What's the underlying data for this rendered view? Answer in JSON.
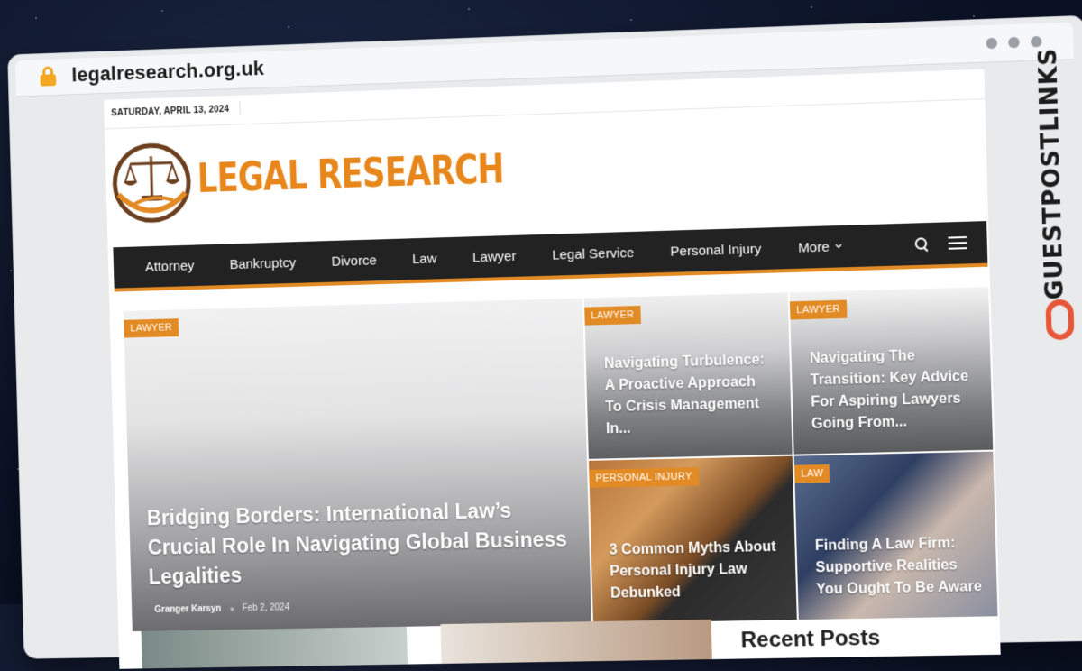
{
  "browser": {
    "url": "legalresearch.org.uk",
    "side_brand": "GUESTPOSTLINKS"
  },
  "site": {
    "date": "SATURDAY, APRIL 13, 2024",
    "name": "LEGAL RESEARCH",
    "nav": [
      "Attorney",
      "Bankruptcy",
      "Divorce",
      "Law",
      "Lawyer",
      "Legal Service",
      "Personal Injury"
    ],
    "more_label": "More"
  },
  "featured": {
    "big": {
      "tag": "LAWYER",
      "title": "Bridging Borders: International Law’s Crucial Role In Navigating Global Business Legalities",
      "author": "Granger Karsyn",
      "date": "Feb 2, 2024"
    },
    "small": [
      {
        "tag": "LAWYER",
        "title": "Navigating Turbulence: A Proactive Approach To Crisis Management In..."
      },
      {
        "tag": "LAWYER",
        "title": "Navigating The Transition: Key Advice For Aspiring Lawyers Going From..."
      },
      {
        "tag": "PERSONAL INJURY",
        "title": "3 Common Myths About Personal Injury Law Debunked"
      },
      {
        "tag": "LAW",
        "title": "Finding A Law Firm: Supportive Realities You Ought To Be Aware"
      }
    ]
  },
  "sidebar": {
    "heading": "Recent Posts"
  },
  "colors": {
    "accent": "#e28a23",
    "nav_bg": "#222222",
    "side_brand_mark": "#e8563a"
  }
}
